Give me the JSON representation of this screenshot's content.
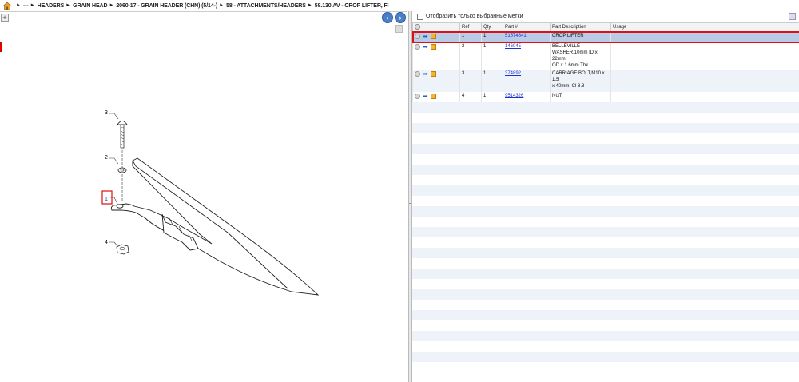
{
  "breadcrumb": {
    "items": [
      "---",
      "HEADERS",
      "GRAIN HEAD",
      "2060-17 - GRAIN HEADER (CHN) (5/14-)",
      "58 - ATTACHMENTS/HEADERS",
      "58.130.AV - CROP LIFTER, FI"
    ],
    "separator": "►"
  },
  "nav": {
    "back": "‹",
    "forward": "›"
  },
  "left_toolbar": {
    "expand": "+"
  },
  "drawing": {
    "callouts": [
      "3",
      "2",
      "1",
      "4"
    ]
  },
  "filter": {
    "label": "Отобразить только выбранные метки"
  },
  "table": {
    "columns": {
      "action": "",
      "ref": "Ref",
      "qty": "Qty",
      "part": "Part #",
      "desc": "Part Description",
      "usage": "Usage"
    },
    "rows": [
      {
        "ref": "1",
        "qty": "1",
        "part": "51574841",
        "desc": [
          "CROP LIFTER"
        ],
        "usage": "",
        "selected": true
      },
      {
        "ref": "2",
        "qty": "1",
        "part": "146045",
        "desc": [
          "BELLEVILLE",
          "WASHER,10mm ID x 22mm",
          "OD x 1.6mm Thk"
        ],
        "usage": "",
        "selected": false
      },
      {
        "ref": "3",
        "qty": "1",
        "part": "374892",
        "desc": [
          "CARRIAGE BOLT,M10 x 1.5",
          "x 40mm, Cl 8.8"
        ],
        "usage": "",
        "selected": false
      },
      {
        "ref": "4",
        "qty": "1",
        "part": "9514326",
        "desc": [
          "NUT"
        ],
        "usage": "",
        "selected": false
      }
    ]
  },
  "colors": {
    "selection": "#b9cbe6",
    "highlight_border": "#d11111",
    "link": "#1a33cc",
    "nav_button": "#4a7fc8"
  },
  "icons": [
    "home-icon",
    "back-arrow-icon",
    "forward-arrow-icon",
    "add-icon",
    "info-icon",
    "return-arrow-icon",
    "package-icon"
  ]
}
